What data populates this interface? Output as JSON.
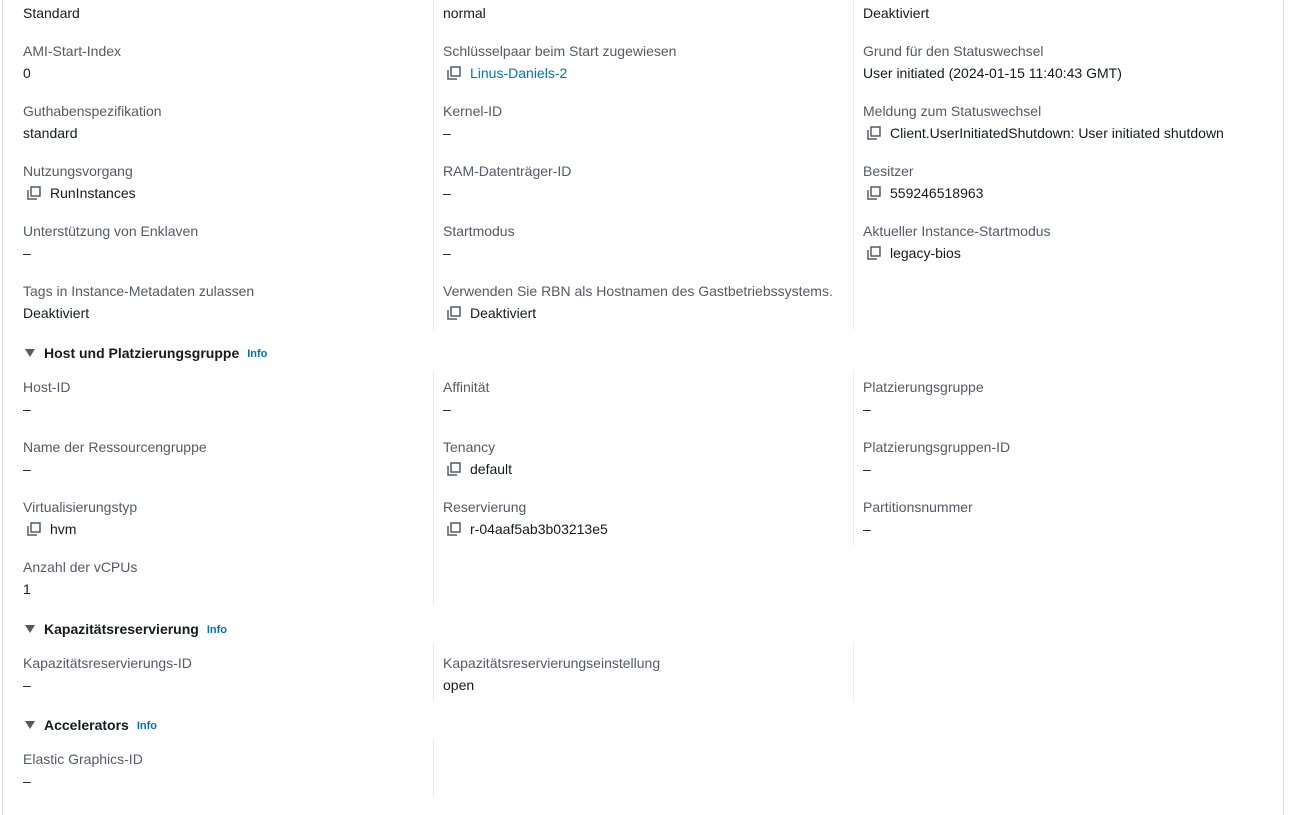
{
  "top_row": {
    "col1_value": "Standard",
    "col2_value": "normal",
    "col3_value": "Deaktiviert"
  },
  "details": {
    "ami_start_index": {
      "label": "AMI-Start-Index",
      "value": "0"
    },
    "key_pair": {
      "label": "Schlüsselpaar beim Start zugewiesen",
      "value": "Linus-Daniels-2"
    },
    "state_reason": {
      "label": "Grund für den Statuswechsel",
      "value": "User initiated (2024-01-15 11:40:43 GMT)"
    },
    "credit_spec": {
      "label": "Guthabenspezifikation",
      "value": "standard"
    },
    "kernel_id": {
      "label": "Kernel-ID",
      "value": "–"
    },
    "state_message": {
      "label": "Meldung zum Statuswechsel",
      "value": "Client.UserInitiatedShutdown: User initiated shutdown"
    },
    "usage_operation": {
      "label": "Nutzungsvorgang",
      "value": "RunInstances"
    },
    "ramdisk_id": {
      "label": "RAM-Datenträger-ID",
      "value": "–"
    },
    "owner": {
      "label": "Besitzer",
      "value": "559246518963"
    },
    "enclave_support": {
      "label": "Unterstützung von Enklaven",
      "value": "–"
    },
    "boot_mode": {
      "label": "Startmodus",
      "value": "–"
    },
    "current_boot_mode": {
      "label": "Aktueller Instance-Startmodus",
      "value": "legacy-bios"
    },
    "metadata_tags": {
      "label": "Tags in Instance-Metadaten zulassen",
      "value": "Deaktiviert"
    },
    "rbn_hostname": {
      "label": "Verwenden Sie RBN als Hostnamen des Gastbetriebssystems.",
      "value": "Deaktiviert"
    }
  },
  "host_section": {
    "title": "Host und Platzierungsgruppe",
    "info": "Info",
    "host_id": {
      "label": "Host-ID",
      "value": "–"
    },
    "affinity": {
      "label": "Affinität",
      "value": "–"
    },
    "placement_group": {
      "label": "Platzierungsgruppe",
      "value": "–"
    },
    "resource_group": {
      "label": "Name der Ressourcengruppe",
      "value": "–"
    },
    "tenancy": {
      "label": "Tenancy",
      "value": "default"
    },
    "placement_group_id": {
      "label": "Platzierungsgruppen-ID",
      "value": "–"
    },
    "virtualization": {
      "label": "Virtualisierungstyp",
      "value": "hvm"
    },
    "reservation": {
      "label": "Reservierung",
      "value": "r-04aaf5ab3b03213e5"
    },
    "partition": {
      "label": "Partitionsnummer",
      "value": "–"
    },
    "vcpus": {
      "label": "Anzahl der vCPUs",
      "value": "1"
    }
  },
  "capacity_section": {
    "title": "Kapazitätsreservierung",
    "info": "Info",
    "reservation_id": {
      "label": "Kapazitätsreservierungs-ID",
      "value": "–"
    },
    "reservation_setting": {
      "label": "Kapazitätsreservierungseinstellung",
      "value": "open"
    }
  },
  "accelerators_section": {
    "title": "Accelerators",
    "info": "Info",
    "elastic_graphics": {
      "label": "Elastic Graphics-ID",
      "value": "–"
    }
  }
}
